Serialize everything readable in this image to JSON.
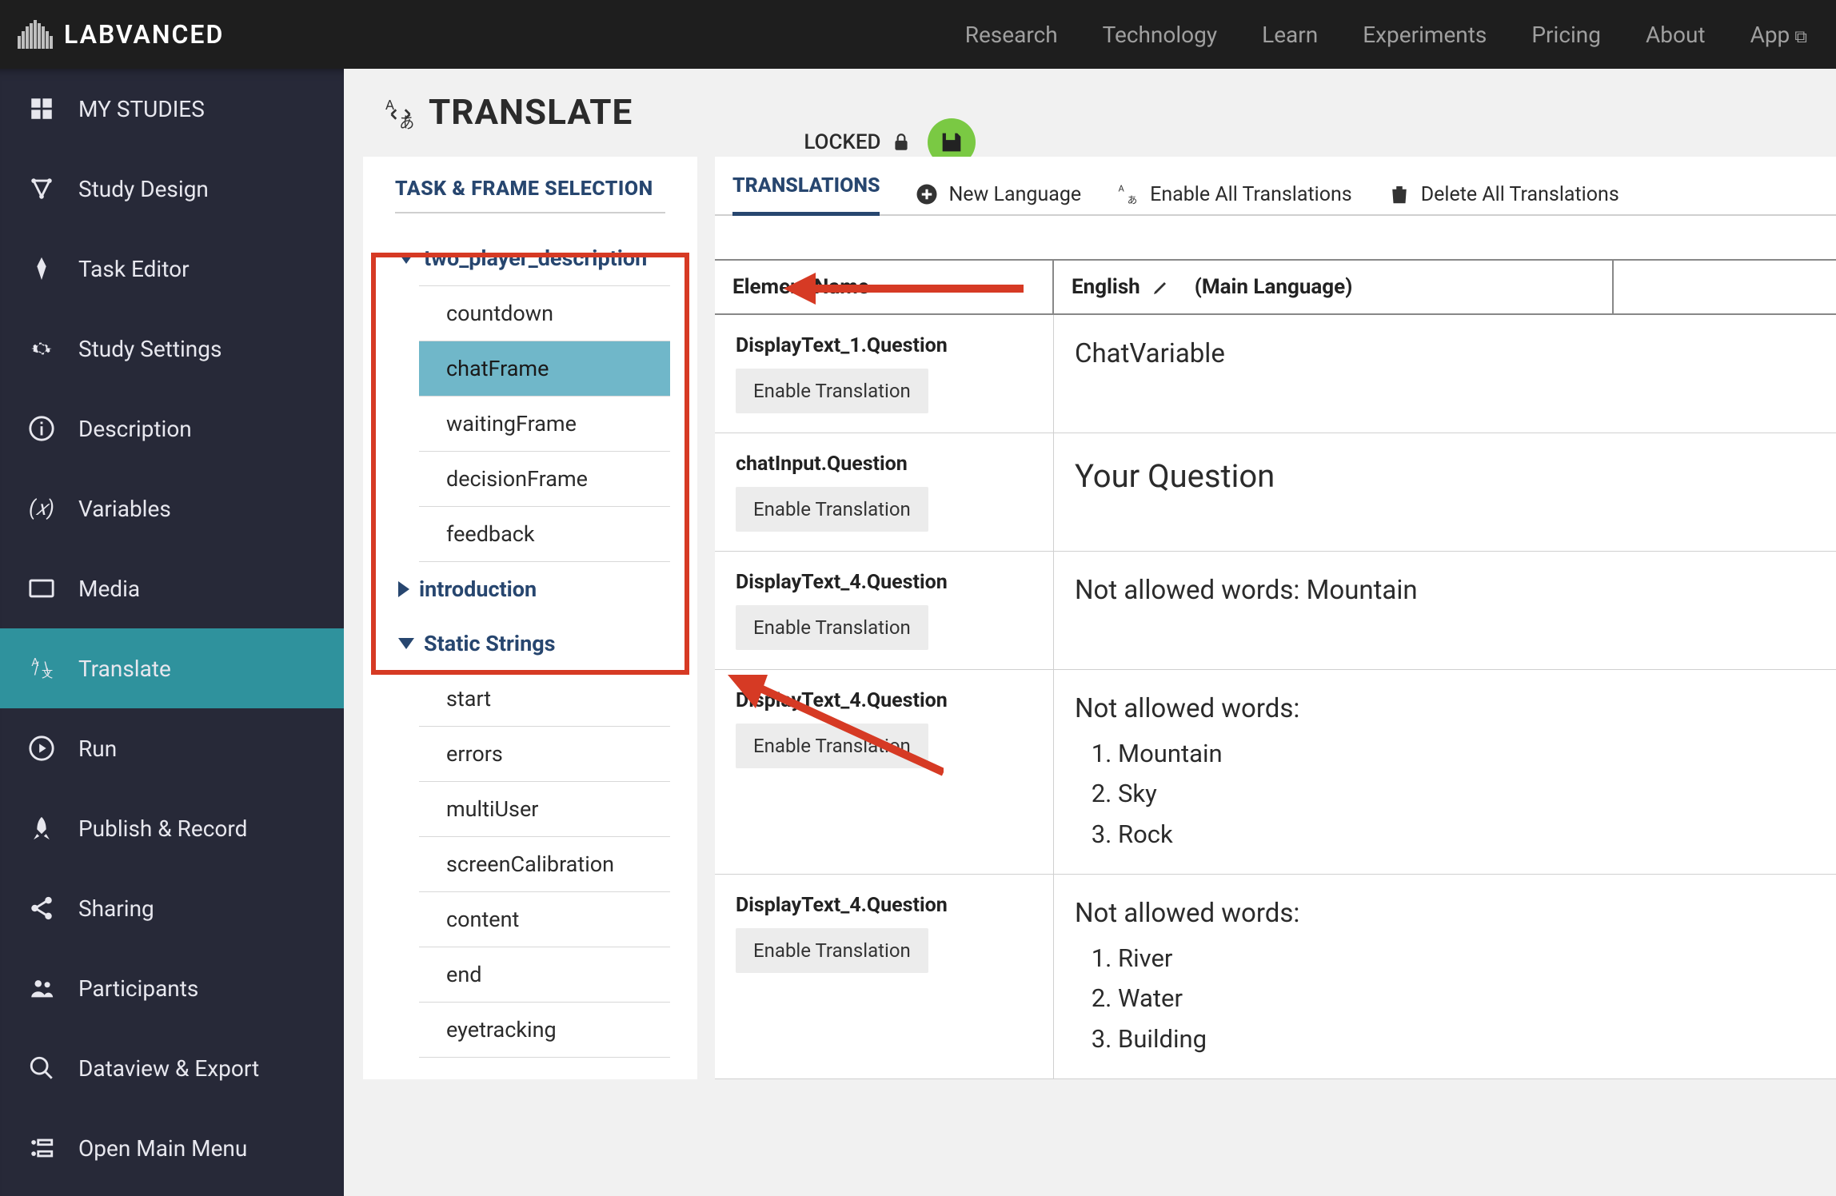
{
  "brand": "LABVANCED",
  "topnav": [
    "Research",
    "Technology",
    "Learn",
    "Experiments",
    "Pricing",
    "About",
    "App"
  ],
  "sidebar": [
    {
      "label": "MY STUDIES",
      "icon": "studies"
    },
    {
      "label": "Study Design",
      "icon": "design"
    },
    {
      "label": "Task Editor",
      "icon": "pen"
    },
    {
      "label": "Study Settings",
      "icon": "gear"
    },
    {
      "label": "Description",
      "icon": "info"
    },
    {
      "label": "Variables",
      "icon": "var"
    },
    {
      "label": "Media",
      "icon": "media"
    },
    {
      "label": "Translate",
      "icon": "translate",
      "active": true
    },
    {
      "label": "Run",
      "icon": "play"
    },
    {
      "label": "Publish & Record",
      "icon": "rocket"
    },
    {
      "label": "Sharing",
      "icon": "share"
    },
    {
      "label": "Participants",
      "icon": "people"
    },
    {
      "label": "Dataview & Export",
      "icon": "search"
    },
    {
      "label": "Open Main Menu",
      "icon": "menu"
    }
  ],
  "header": {
    "title": "TRANSLATE",
    "locked": "LOCKED"
  },
  "leftPanel": {
    "title": "TASK & FRAME SELECTION",
    "tree": [
      {
        "label": "two_player_description",
        "expanded": true,
        "children": [
          {
            "label": "countdown"
          },
          {
            "label": "chatFrame",
            "selected": true
          },
          {
            "label": "waitingFrame"
          },
          {
            "label": "decisionFrame"
          },
          {
            "label": "feedback"
          }
        ]
      },
      {
        "label": "introduction",
        "expanded": false,
        "children": []
      },
      {
        "label": "Static Strings",
        "expanded": true,
        "children": [
          {
            "label": "start"
          },
          {
            "label": "errors"
          },
          {
            "label": "multiUser"
          },
          {
            "label": "screenCalibration"
          },
          {
            "label": "content"
          },
          {
            "label": "end"
          },
          {
            "label": "eyetracking"
          }
        ]
      }
    ]
  },
  "rightPanel": {
    "tab": "TRANSLATIONS",
    "actions": {
      "new": "New Language",
      "enable": "Enable All Translations",
      "delete": "Delete All Translations"
    },
    "columns": {
      "element": "Element Name",
      "lang": "English",
      "mainSuffix": "(Main Language)"
    },
    "enableBtn": "Enable Translation",
    "rows": [
      {
        "el": "DisplayText_1.Question",
        "html": "ChatVariable"
      },
      {
        "el": "chatInput.Question",
        "html": "Your Question",
        "big": true
      },
      {
        "el": "DisplayText_4.Question",
        "html": "Not allowed words: Mountain"
      },
      {
        "el": "DisplayText_4.Question",
        "list": {
          "lead": "Not allowed words:",
          "items": [
            "Mountain",
            "Sky",
            "Rock"
          ]
        }
      },
      {
        "el": "DisplayText_4.Question",
        "list": {
          "lead": "Not allowed words:",
          "items": [
            "River",
            "Water",
            "Building"
          ]
        }
      }
    ]
  }
}
